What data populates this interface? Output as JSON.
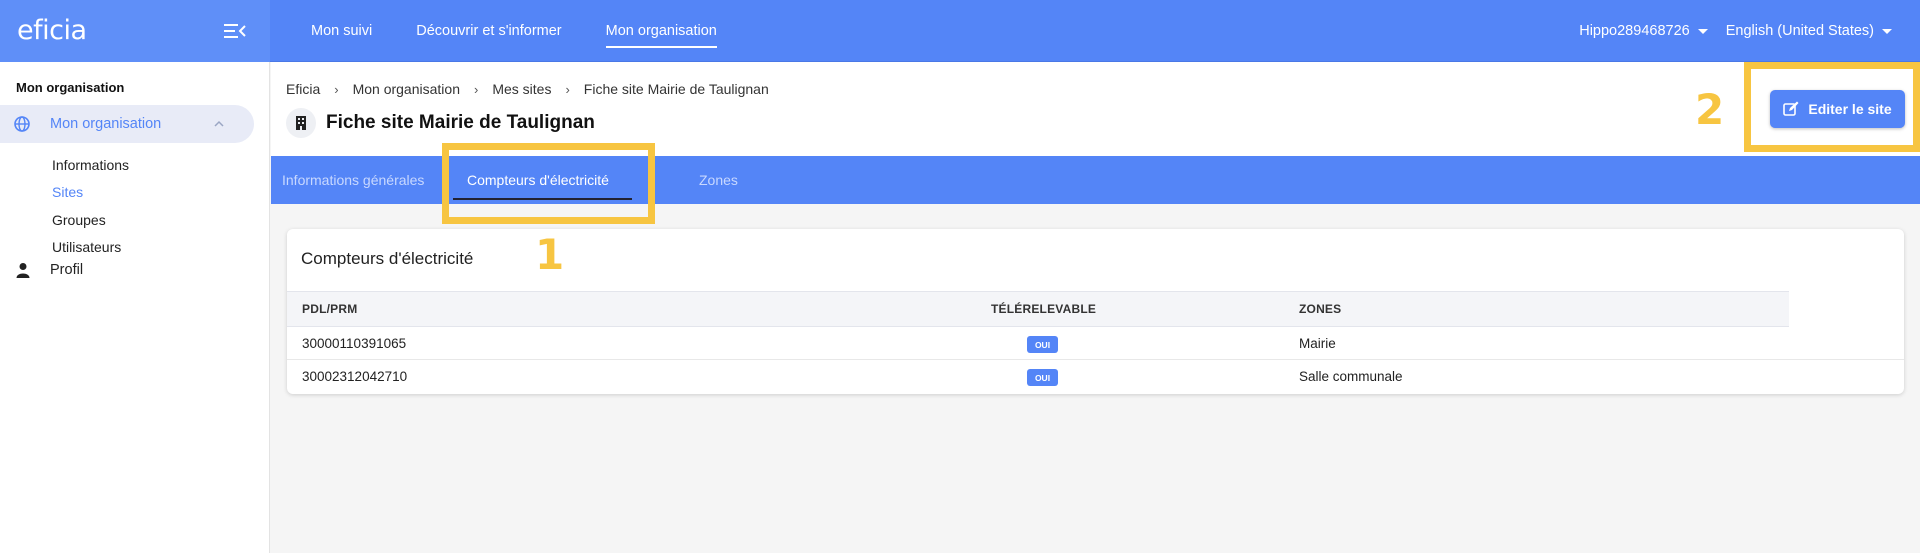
{
  "app": {
    "logo": "eficia"
  },
  "topnav": {
    "items": [
      {
        "label": "Mon suivi"
      },
      {
        "label": "Découvrir et s'informer"
      },
      {
        "label": "Mon organisation"
      }
    ],
    "user": "Hippo289468726",
    "language": "English (United States)"
  },
  "sidebar": {
    "title": "Mon organisation",
    "group_label": "Mon organisation",
    "subitems": [
      "Informations",
      "Sites",
      "Groupes",
      "Utilisateurs"
    ],
    "profile_label": "Profil"
  },
  "breadcrumb": [
    "Eficia",
    "Mon organisation",
    "Mes sites",
    "Fiche site Mairie de Taulignan"
  ],
  "page_title": "Fiche site Mairie de Taulignan",
  "edit_button": "Editer le site",
  "tabs": [
    "Informations générales",
    "Compteurs d'électricité",
    "Zones"
  ],
  "active_tab": "Compteurs d'électricité",
  "callouts": [
    "1",
    "2"
  ],
  "card": {
    "title": "Compteurs d'électricité",
    "columns": [
      "PDL/PRM",
      "TÉLÉRELEVABLE",
      "ZONES"
    ],
    "rows": [
      {
        "pdl": "30000110391065",
        "telerelevable": "OUI",
        "zone": "Mairie"
      },
      {
        "pdl": "30002312042710",
        "telerelevable": "OUI",
        "zone": "Salle communale"
      }
    ]
  },
  "colors": {
    "primary": "#5485f7",
    "highlight": "#f7c541",
    "sidebar_active_bg": "#e8ebf7"
  }
}
